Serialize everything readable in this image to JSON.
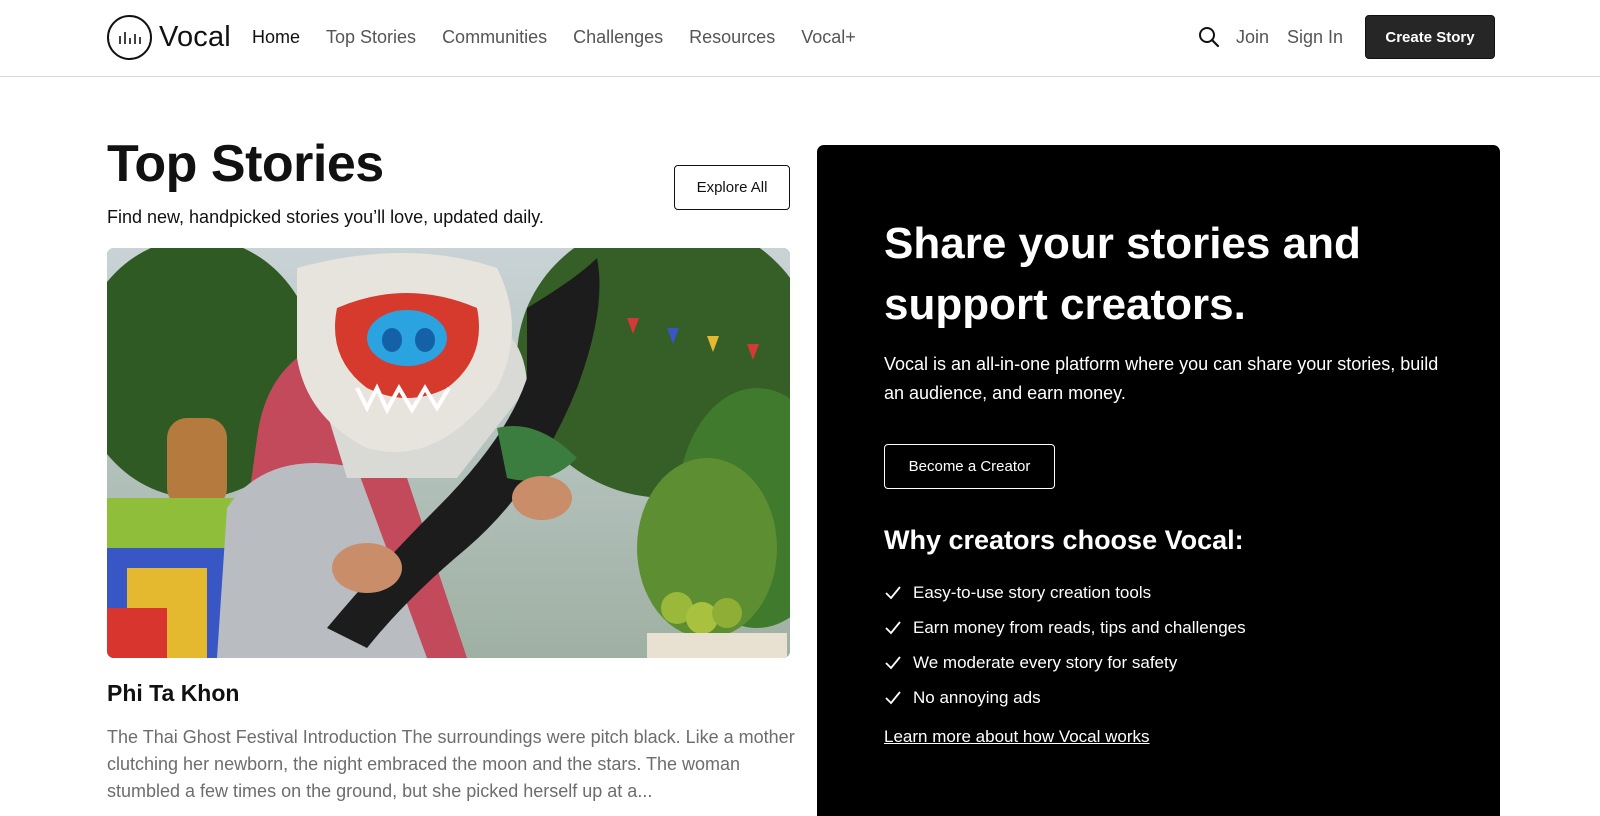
{
  "header": {
    "logo_text": "Vocal",
    "nav": [
      {
        "label": "Home",
        "active": true
      },
      {
        "label": "Top Stories",
        "active": false
      },
      {
        "label": "Communities",
        "active": false
      },
      {
        "label": "Challenges",
        "active": false
      },
      {
        "label": "Resources",
        "active": false
      },
      {
        "label": "Vocal+",
        "active": false
      }
    ],
    "join_label": "Join",
    "signin_label": "Sign In",
    "create_label": "Create Story"
  },
  "top_stories": {
    "title": "Top Stories",
    "subtitle": "Find new, handpicked stories you’ll love, updated daily.",
    "explore_label": "Explore All",
    "story": {
      "title": "Phi Ta Khon",
      "excerpt": "The Thai Ghost Festival Introduction The surroundings were pitch black. Like a mother clutching her newborn, the night embraced the moon and the stars. The woman stumbled a few times on the ground, but she picked herself up at a..."
    }
  },
  "promo": {
    "title": "Share your stories and support creators.",
    "description": "Vocal is an all-in-one platform where you can share your stories, build an audience, and earn money.",
    "button_label": "Become a Creator",
    "why_title": "Why creators choose Vocal:",
    "reasons": [
      "Easy-to-use story creation tools",
      "Earn money from reads, tips and challenges",
      "We moderate every story for safety",
      "No annoying ads"
    ],
    "learn_more": "Learn more about how Vocal works"
  },
  "colors": {
    "create_button_bg": "#262626",
    "promo_bg": "#000000",
    "excerpt_text": "#6d6d6d"
  },
  "icons": [
    "vocal-logo-icon",
    "search-icon",
    "checkmark-icon"
  ]
}
